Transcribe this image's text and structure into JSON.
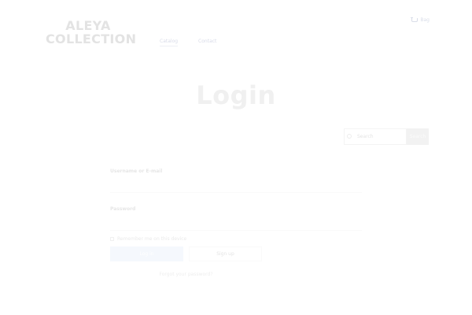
{
  "header": {
    "brand_line1": "ALEYA",
    "brand_line2": "COLLECTION",
    "nav": [
      {
        "label": "Catalog",
        "active": true
      },
      {
        "label": "Contact",
        "active": false
      }
    ],
    "cart_label": "Bag"
  },
  "main": {
    "title": "Login",
    "search": {
      "placeholder": "Search",
      "button_label": "Search"
    },
    "form": {
      "username_label": "Username or E-mail",
      "username_value": "",
      "password_label": "Password",
      "password_value": "",
      "remember_label": "Remember me on this device",
      "login_label": "Log in",
      "register_label": "Sign up",
      "lost_password_label": "Forgot your password?"
    }
  }
}
